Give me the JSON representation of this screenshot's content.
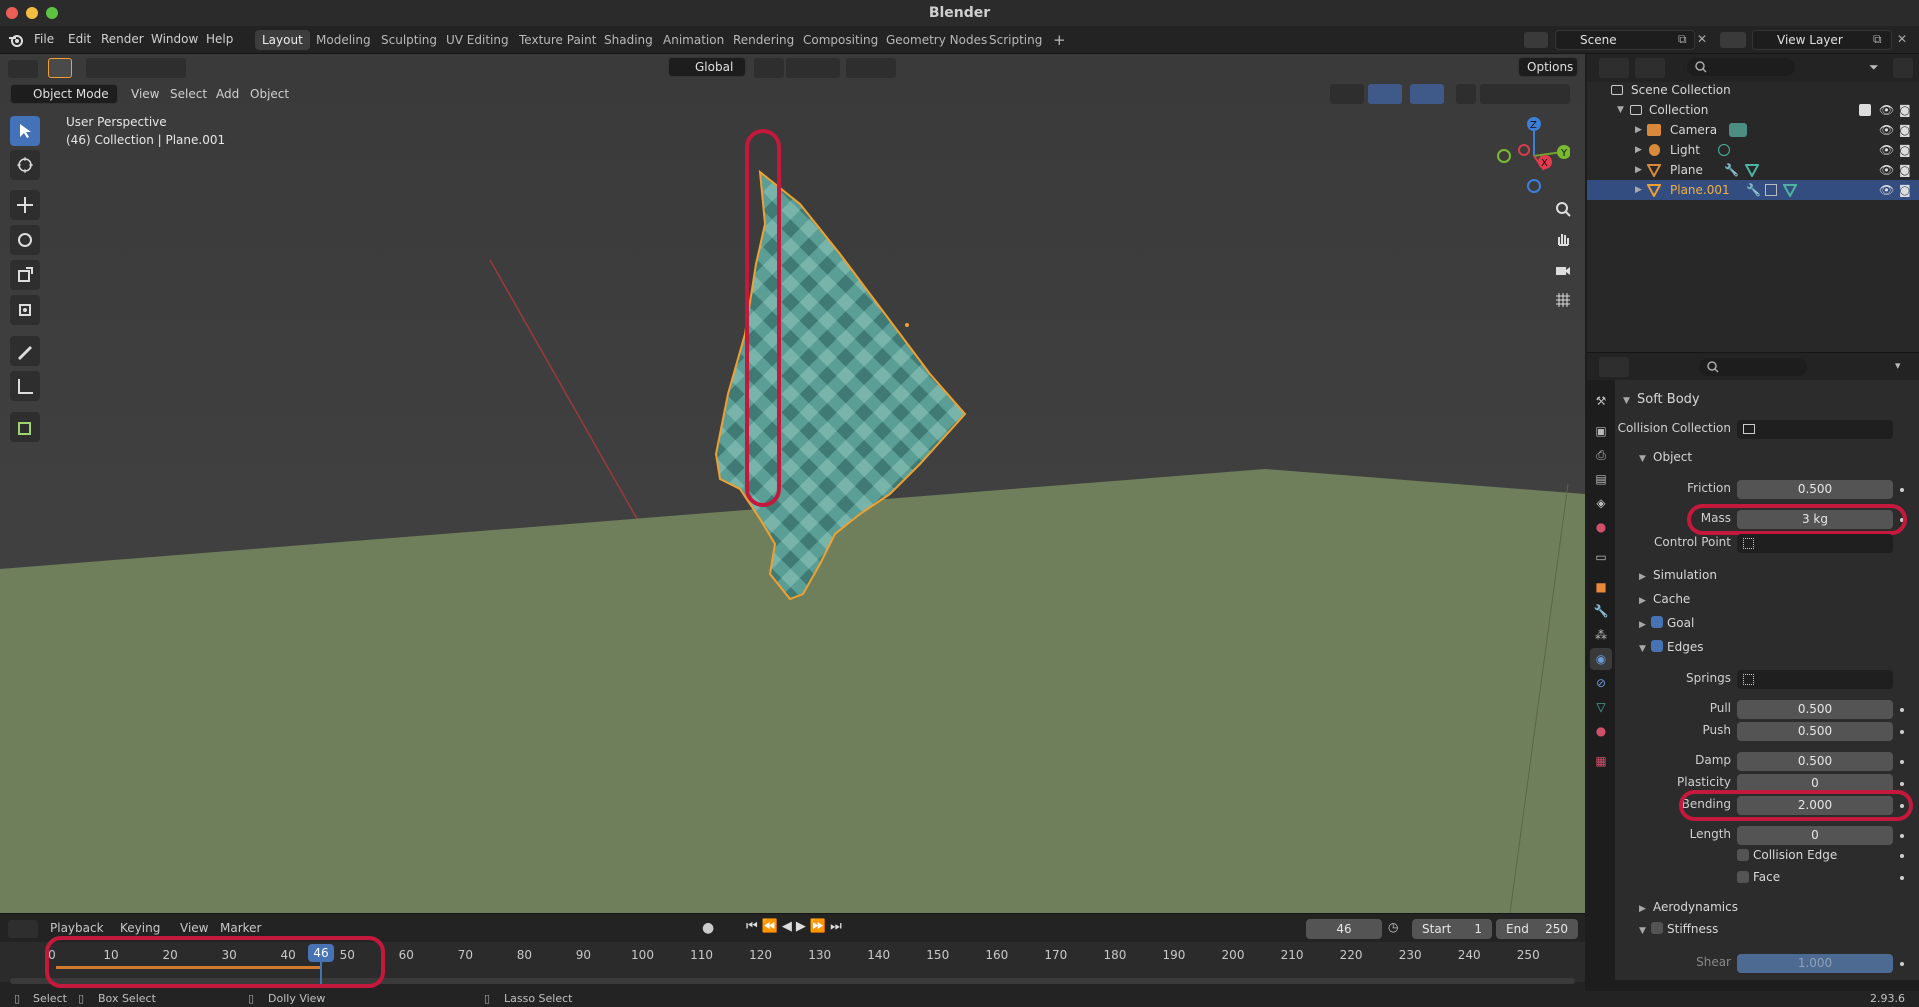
{
  "window": {
    "title": "Blender"
  },
  "menu": [
    "File",
    "Edit",
    "Render",
    "Window",
    "Help"
  ],
  "workspaces": [
    "Layout",
    "Modeling",
    "Sculpting",
    "UV Editing",
    "Texture Paint",
    "Shading",
    "Animation",
    "Rendering",
    "Compositing",
    "Geometry Nodes",
    "Scripting"
  ],
  "scene": {
    "name": "Scene",
    "view_layer": "View Layer"
  },
  "viewport": {
    "mode": "Object Mode",
    "menus": [
      "View",
      "Select",
      "Add",
      "Object"
    ],
    "transform_orientation": "Global",
    "options": "Options",
    "overlay_line1": "User Perspective",
    "overlay_line2": "(46) Collection | Plane.001",
    "gizmo": {
      "z": "Z",
      "y": "Y",
      "x": "X"
    }
  },
  "outliner": {
    "root": "Scene Collection",
    "collection": "Collection",
    "objects": [
      "Camera",
      "Light",
      "Plane",
      "Plane.001"
    ]
  },
  "properties": {
    "panel": "Soft Body",
    "collision_collection_label": "Collision Collection",
    "object_section": "Object",
    "friction_label": "Friction",
    "friction": "0.500",
    "mass_label": "Mass",
    "mass": "3 kg",
    "control_point_label": "Control Point",
    "simulation": "Simulation",
    "cache": "Cache",
    "goal": "Goal",
    "edges": "Edges",
    "springs_label": "Springs",
    "pull_label": "Pull",
    "pull": "0.500",
    "push_label": "Push",
    "push": "0.500",
    "damp_label": "Damp",
    "damp": "0.500",
    "plasticity_label": "Plasticity",
    "plasticity": "0",
    "bending_label": "Bending",
    "bending": "2.000",
    "length_label": "Length",
    "length": "0",
    "collision_edge": "Collision Edge",
    "face": "Face",
    "aerodynamics": "Aerodynamics",
    "stiffness": "Stiffness",
    "shear_label": "Shear",
    "shear": "1.000"
  },
  "timeline": {
    "menus": [
      "Playback",
      "Keying",
      "View",
      "Marker"
    ],
    "current_frame": "46",
    "start_label": "Start",
    "start": "1",
    "end_label": "End",
    "end": "250",
    "ticks": [
      "0",
      "10",
      "20",
      "30",
      "40",
      "50",
      "60",
      "70",
      "80",
      "90",
      "100",
      "110",
      "120",
      "130",
      "140",
      "150",
      "160",
      "170",
      "180",
      "190",
      "200",
      "210",
      "220",
      "230",
      "240",
      "250"
    ]
  },
  "statusbar": {
    "select": "Select",
    "box_select": "Box Select",
    "dolly_view": "Dolly View",
    "lasso_select": "Lasso Select",
    "version": "2.93.6"
  },
  "colors": {
    "accent": "#4772b3",
    "highlight": "#c4193c",
    "mesh": "#5a9e95",
    "outline": "#f0a030"
  }
}
